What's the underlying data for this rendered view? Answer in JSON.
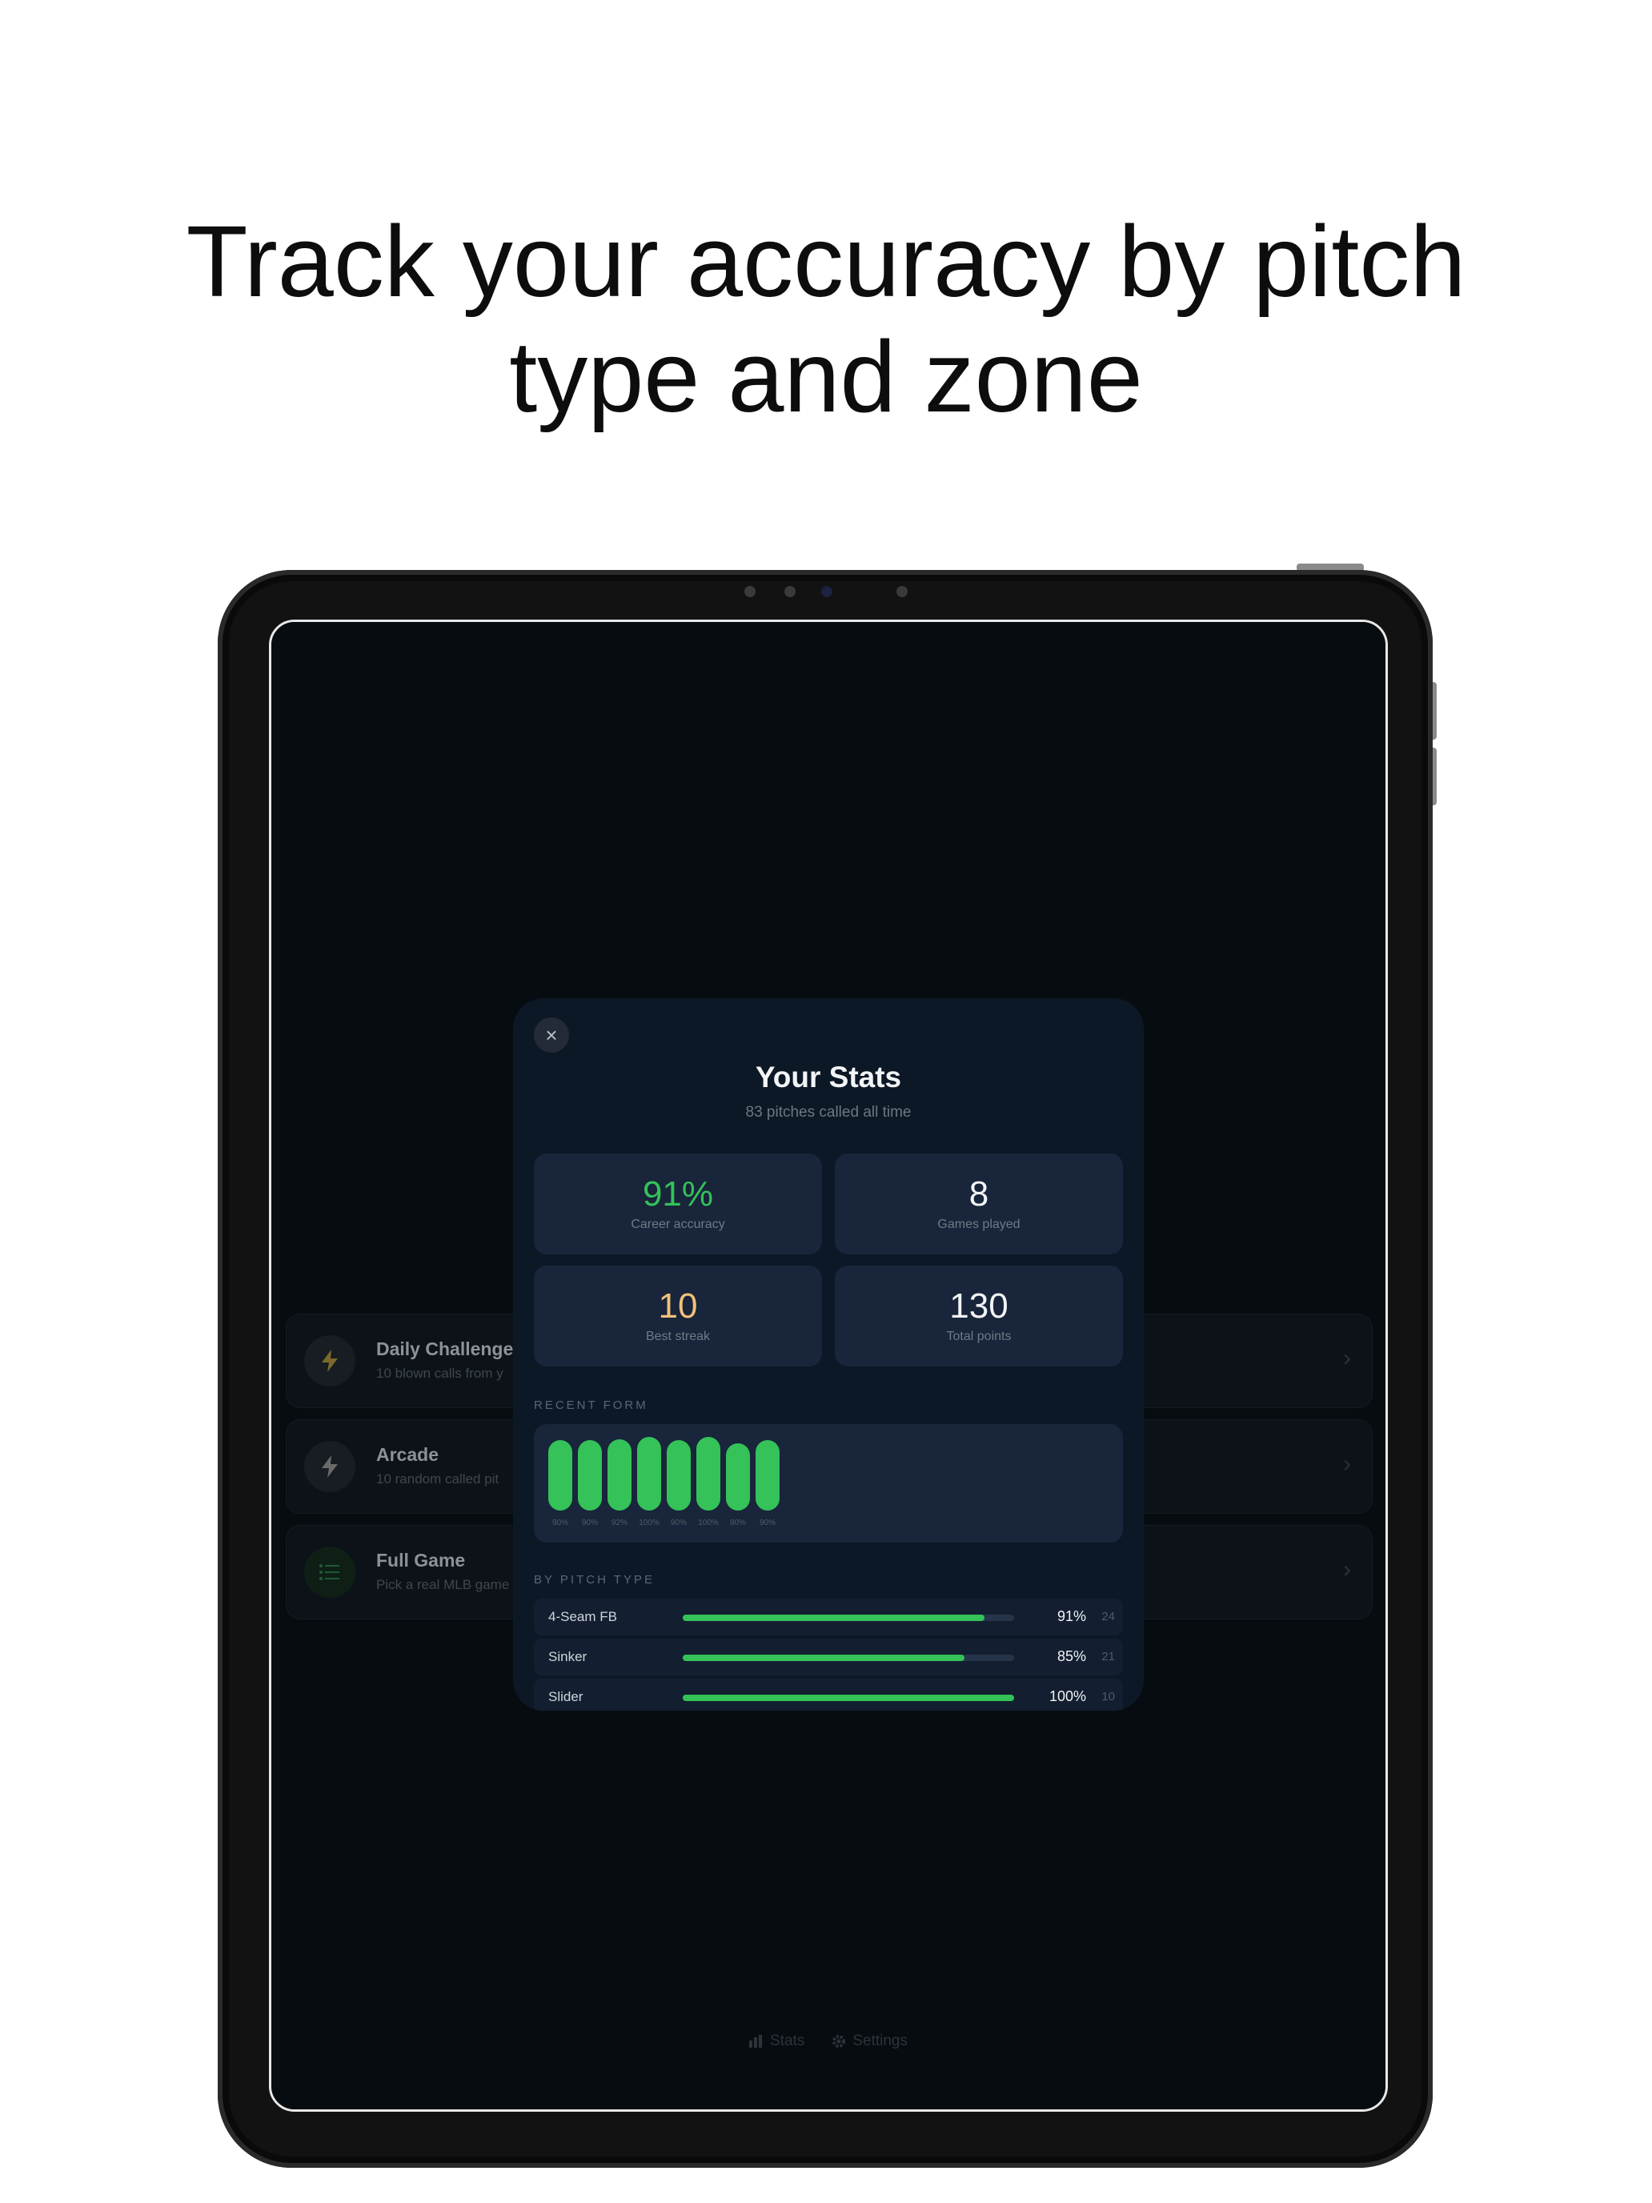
{
  "headline": {
    "line1": "Track your accuracy by pitch",
    "line2": "type and zone"
  },
  "menu": [
    {
      "title": "Daily Challenge",
      "subtitle": "10 blown calls from y",
      "icon": "bolt-icon",
      "icon_color": "#7a6a2a"
    },
    {
      "title": "Arcade",
      "subtitle": "10 random called pit",
      "icon": "bolt-icon",
      "icon_color": "#6a6a6a"
    },
    {
      "title": "Full Game",
      "subtitle": "Pick a real MLB game",
      "icon": "list-icon",
      "icon_color": "#1f5a33"
    }
  ],
  "tabbar": {
    "stats_label": "Stats",
    "settings_label": "Settings"
  },
  "modal": {
    "title": "Your Stats",
    "subtitle": "83 pitches called all time",
    "stats": [
      {
        "value": "91%",
        "label": "Career accuracy",
        "color": "#34c259"
      },
      {
        "value": "8",
        "label": "Games played",
        "color": "#f2f4f6"
      },
      {
        "value": "10",
        "label": "Best streak",
        "color": "#f3c178"
      },
      {
        "value": "130",
        "label": "Total points",
        "color": "#f2f4f6"
      }
    ],
    "recent_form_label": "RECENT FORM",
    "recent_form": [
      {
        "pct": 90,
        "label": "90%"
      },
      {
        "pct": 90,
        "label": "90%"
      },
      {
        "pct": 92,
        "label": "92%"
      },
      {
        "pct": 100,
        "label": "100%"
      },
      {
        "pct": 90,
        "label": "90%"
      },
      {
        "pct": 100,
        "label": "100%"
      },
      {
        "pct": 80,
        "label": "80%"
      },
      {
        "pct": 90,
        "label": "90%"
      }
    ],
    "by_pitch_label": "BY PITCH TYPE",
    "pitches": [
      {
        "name": "4-Seam FB",
        "pct": 91,
        "pct_label": "91%",
        "count": "24"
      },
      {
        "name": "Sinker",
        "pct": 85,
        "pct_label": "85%",
        "count": "21"
      },
      {
        "name": "Slider",
        "pct": 100,
        "pct_label": "100%",
        "count": "10"
      }
    ]
  },
  "colors": {
    "accent_green": "#34c259",
    "streak_gold": "#f3c178",
    "screen_bg": "#070c11",
    "modal_bg": "#0d1826"
  }
}
